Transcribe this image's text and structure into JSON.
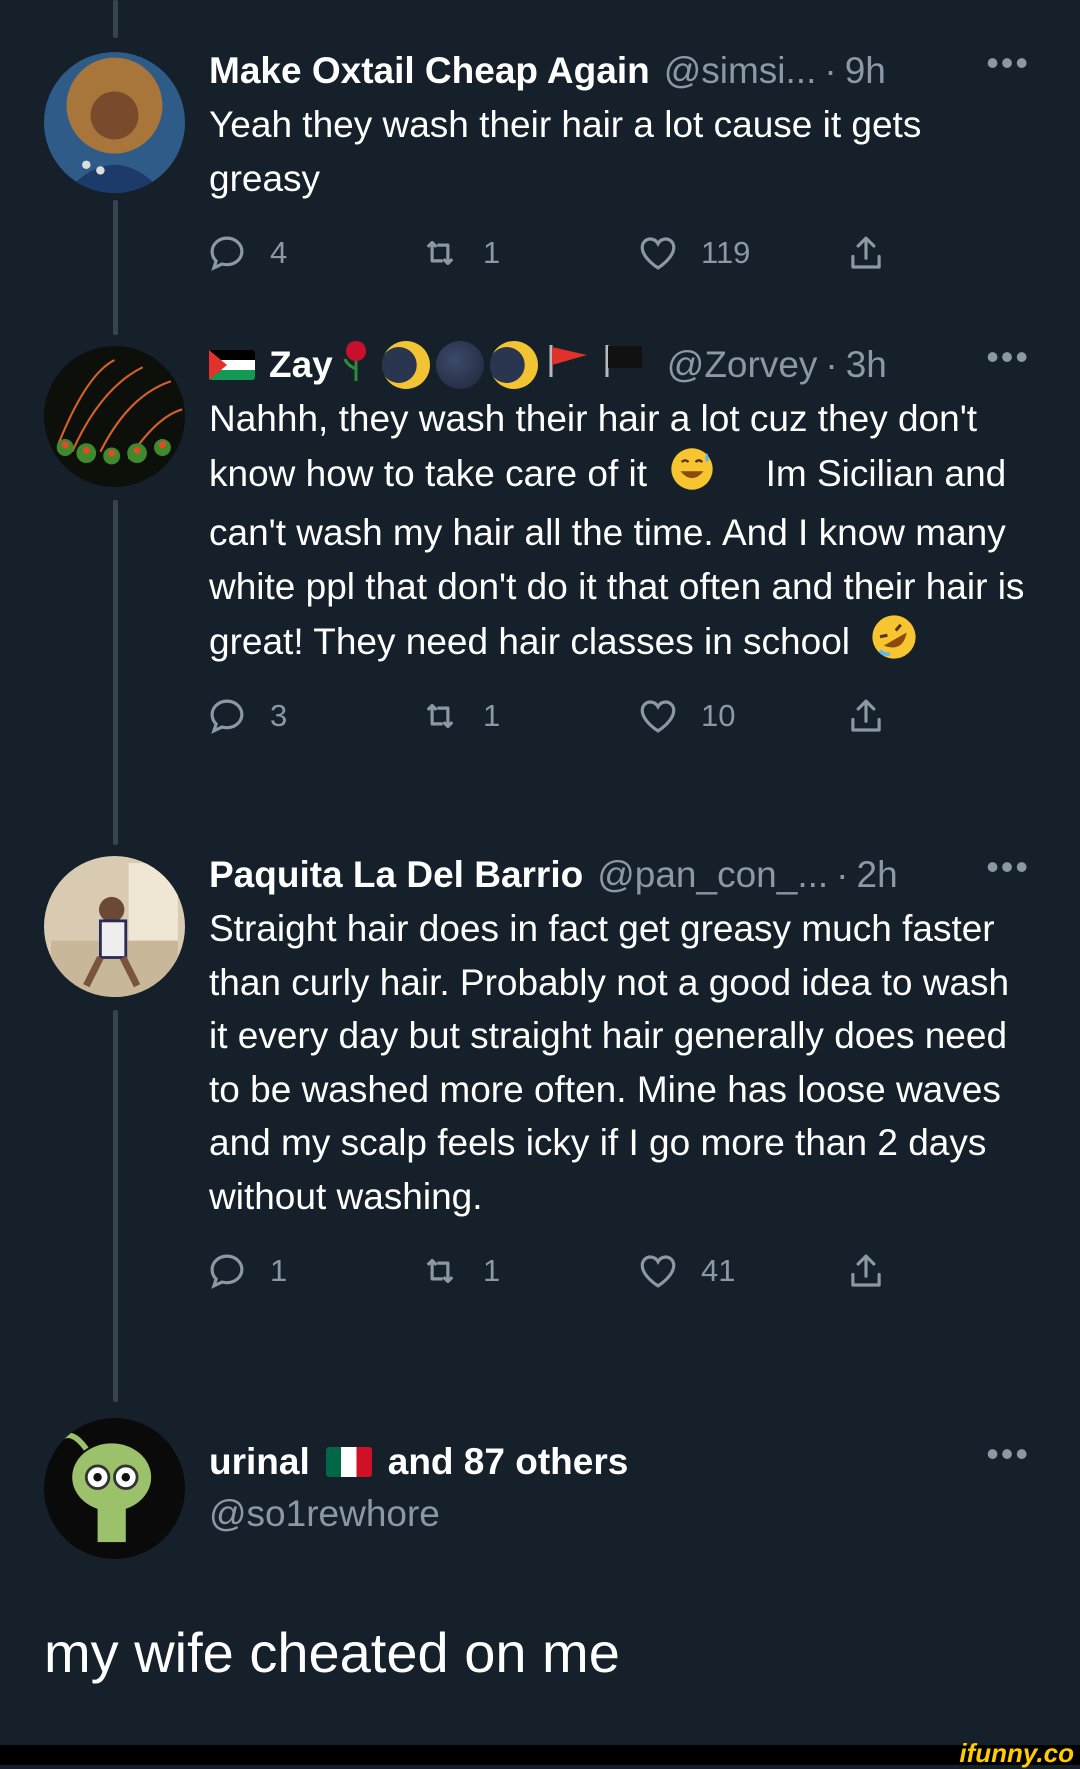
{
  "tweets": [
    {
      "name": "Make Oxtail Cheap Again",
      "handle": "@simsi...",
      "separator": "·",
      "time": "9h",
      "text": "Yeah they wash their hair a lot cause it gets greasy",
      "replies": "4",
      "retweets": "1",
      "likes": "119"
    },
    {
      "name": "Zay",
      "handle": "@Zorvey",
      "separator": "·",
      "time": "3h",
      "text_part1": "Nahhh, they wash their hair a lot cuz they don't know how to take care of it",
      "text_part2": "Im Sicilian and can't wash my hair all the time. And I know many white ppl that don't do it that often and their hair is great! They need hair classes in school",
      "replies": "3",
      "retweets": "1",
      "likes": "10"
    },
    {
      "name": "Paquita La Del Barrio",
      "handle": "@pan_con_...",
      "separator": "·",
      "time": "2h",
      "text": "Straight hair does in fact get greasy much faster than curly hair. Probably not a good idea to wash it every day but straight hair generally does need to be washed more often. Mine has loose waves and my scalp feels icky if I go more than 2 days without washing.",
      "replies": "1",
      "retweets": "1",
      "likes": "41"
    }
  ],
  "main_tweet": {
    "name_part1": "urinal",
    "name_part2": "and 87 others",
    "handle": "@so1rewhore",
    "text": "my wife cheated on me"
  },
  "more_glyph": "•••",
  "watermark": "ifunny.co",
  "colors": {
    "background": "#15202b",
    "secondary_text": "#8b98a5",
    "thread_line": "#38444d"
  }
}
